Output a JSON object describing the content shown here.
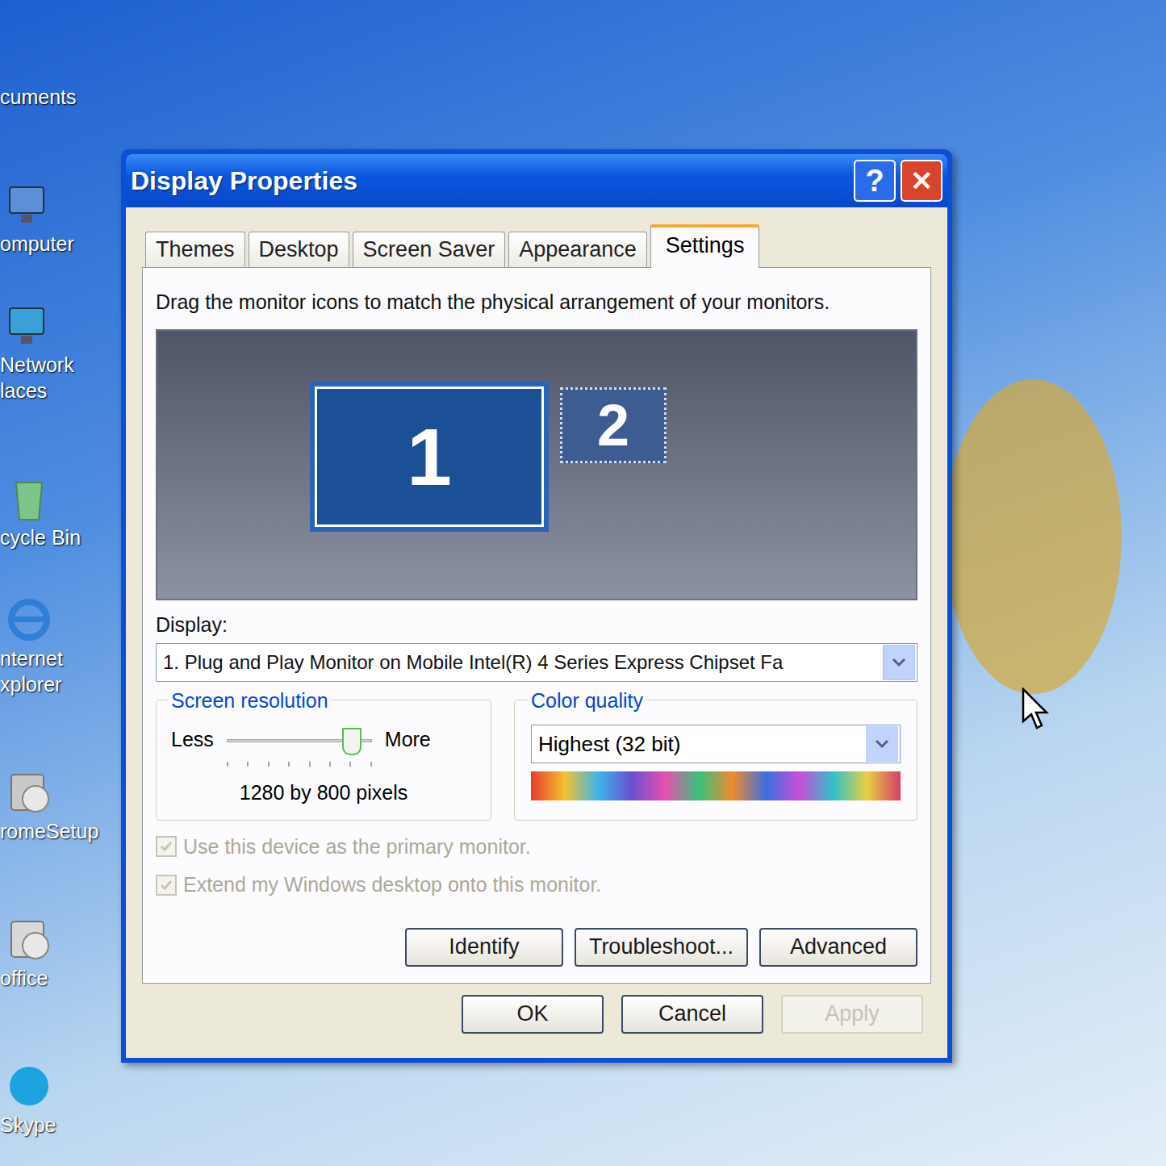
{
  "desktop": {
    "icons": [
      {
        "lines": [
          "cuments"
        ],
        "kind": "folder"
      },
      {
        "lines": [
          "omputer"
        ],
        "kind": "computer"
      },
      {
        "lines": [
          "Network",
          "laces"
        ],
        "kind": "network"
      },
      {
        "lines": [
          "cycle Bin"
        ],
        "kind": "recycle"
      },
      {
        "lines": [
          "nternet",
          "xplorer"
        ],
        "kind": "browser"
      },
      {
        "lines": [
          "romeSetup"
        ],
        "kind": "setup"
      },
      {
        "lines": [
          "office"
        ],
        "kind": "shortcut"
      },
      {
        "lines": [
          "Skype"
        ],
        "kind": "skype"
      }
    ]
  },
  "window": {
    "title": "Display Properties",
    "help": "?",
    "close": "✕"
  },
  "tabs": [
    {
      "label": "Themes",
      "selected": false
    },
    {
      "label": "Desktop",
      "selected": false
    },
    {
      "label": "Screen Saver",
      "selected": false
    },
    {
      "label": "Appearance",
      "selected": false
    },
    {
      "label": "Settings",
      "selected": true
    }
  ],
  "instruction": "Drag the monitor icons to match the physical arrangement of your monitors.",
  "monitors": [
    {
      "label": "1",
      "selected": true,
      "attached": true
    },
    {
      "label": "2",
      "selected": false,
      "attached": false
    }
  ],
  "display": {
    "label": "Display:",
    "value": "1. Plug and Play Monitor on Mobile Intel(R) 4 Series Express Chipset Fa"
  },
  "resolution": {
    "title": "Screen resolution",
    "less": "Less",
    "more": "More",
    "level": 0.92,
    "reading": "1280 by 800 pixels"
  },
  "color_quality": {
    "title": "Color quality",
    "value": "Highest (32 bit)"
  },
  "checkboxes": [
    {
      "label": "Use this device as the primary monitor.",
      "checked": true,
      "disabled": true
    },
    {
      "label": "Extend my Windows desktop onto this monitor.",
      "checked": true,
      "disabled": true
    }
  ],
  "actions": [
    {
      "label": "Identify",
      "disabled": false
    },
    {
      "label": "Troubleshoot...",
      "disabled": false
    },
    {
      "label": "Advanced",
      "disabled": false
    }
  ],
  "buttons": [
    {
      "label": "OK",
      "disabled": false
    },
    {
      "label": "Cancel",
      "disabled": false
    },
    {
      "label": "Apply",
      "disabled": true
    }
  ]
}
